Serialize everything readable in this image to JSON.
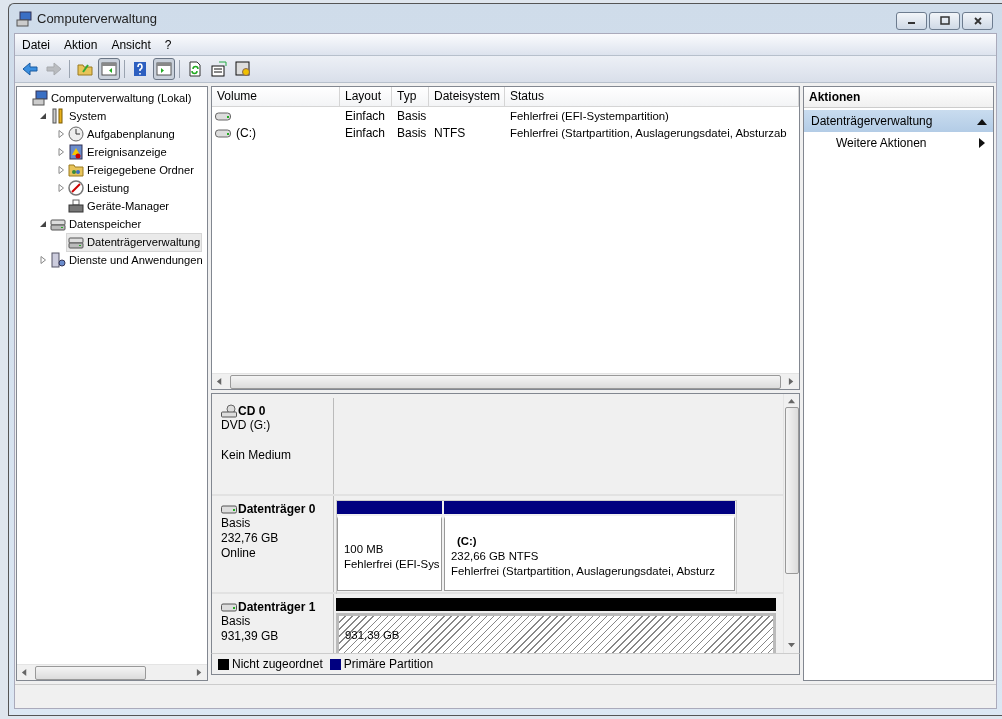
{
  "window": {
    "title": "Computerverwaltung"
  },
  "menu": [
    "Datei",
    "Aktion",
    "Ansicht",
    "?"
  ],
  "toolbar": [
    {
      "kind": "back",
      "disabled": false,
      "pressed": false
    },
    {
      "kind": "forward",
      "disabled": true,
      "pressed": false
    },
    {
      "kind": "up",
      "disabled": false,
      "pressed": false
    },
    {
      "kind": "tree-toggle",
      "disabled": false,
      "pressed": true
    },
    {
      "kind": "help",
      "disabled": false,
      "pressed": false
    },
    {
      "kind": "pane-toggle",
      "disabled": false,
      "pressed": true
    },
    {
      "kind": "refresh",
      "disabled": false,
      "pressed": false
    },
    {
      "kind": "properties",
      "disabled": false,
      "pressed": false
    },
    {
      "kind": "settings",
      "disabled": false,
      "pressed": false
    }
  ],
  "tree": [
    {
      "label": "Computerverwaltung (Lokal)",
      "kind": "computer",
      "selected": false,
      "children": [
        {
          "label": "System",
          "kind": "tools",
          "expanded": true,
          "selected": false,
          "children": [
            {
              "label": "Aufgabenplanung",
              "kind": "clock",
              "expanded": false,
              "selected": false
            },
            {
              "label": "Ereignisanzeige",
              "kind": "log",
              "expanded": false,
              "selected": false
            },
            {
              "label": "Freigegebene Ordner",
              "kind": "folder",
              "expanded": false,
              "selected": false
            },
            {
              "label": "Leistung",
              "kind": "gauge",
              "expanded": false,
              "selected": false
            },
            {
              "label": "Geräte-Manager",
              "kind": "devices",
              "selected": false
            }
          ]
        },
        {
          "label": "Datenspeicher",
          "kind": "storage",
          "expanded": true,
          "selected": false,
          "children": [
            {
              "label": "Datenträgerverwaltung",
              "kind": "disk-manager",
              "selected": true
            }
          ]
        },
        {
          "label": "Dienste und Anwendungen",
          "kind": "services",
          "expanded": false,
          "selected": false
        }
      ]
    }
  ],
  "table": {
    "columns": [
      "Volume",
      "Layout",
      "Typ",
      "Dateisystem",
      "Status"
    ],
    "rows": [
      {
        "layout": "Einfach",
        "typ": "Basis",
        "status": "Fehlerfrei (EFI-Systempartition)"
      },
      {
        "volume": "(C:)",
        "layout": "Einfach",
        "typ": "Basis",
        "dateisystem": "NTFS",
        "status": "Fehlerfrei (Startpartition, Auslagerungsdatei, Absturzab"
      }
    ]
  },
  "disks": [
    {
      "kind": "cd",
      "name": "CD 0",
      "type": "DVD (G:)",
      "status": "Kein Medium"
    },
    {
      "kind": "disk",
      "name": "Datenträger 0",
      "type": "Basis",
      "size": "232,76 GB",
      "status": "Online",
      "partitions": [
        {
          "kind": "primary",
          "color": "#000080",
          "size": "100 MB",
          "status": "Fehlerfrei (EFI-Sys"
        },
        {
          "kind": "primary",
          "color": "#000080",
          "label": "(C:)",
          "size": "232,66 GB NTFS",
          "status": "Fehlerfrei (Startpartition, Auslagerungsdatei, Absturz"
        }
      ]
    },
    {
      "kind": "disk",
      "name": "Datenträger 1",
      "type": "Basis",
      "size": "931,39 GB",
      "partitions": [
        {
          "kind": "unallocated",
          "color": "#000000",
          "size": "931,39 GB"
        }
      ]
    }
  ],
  "legend": [
    {
      "label": "Nicht zugeordnet",
      "color": "#000000"
    },
    {
      "label": "Primäre Partition",
      "color": "#000080"
    }
  ],
  "actions": {
    "title": "Aktionen",
    "sections": [
      {
        "label": "Datenträgerverwaltung",
        "expanded": true,
        "items": [
          "Weitere Aktionen"
        ]
      }
    ]
  }
}
